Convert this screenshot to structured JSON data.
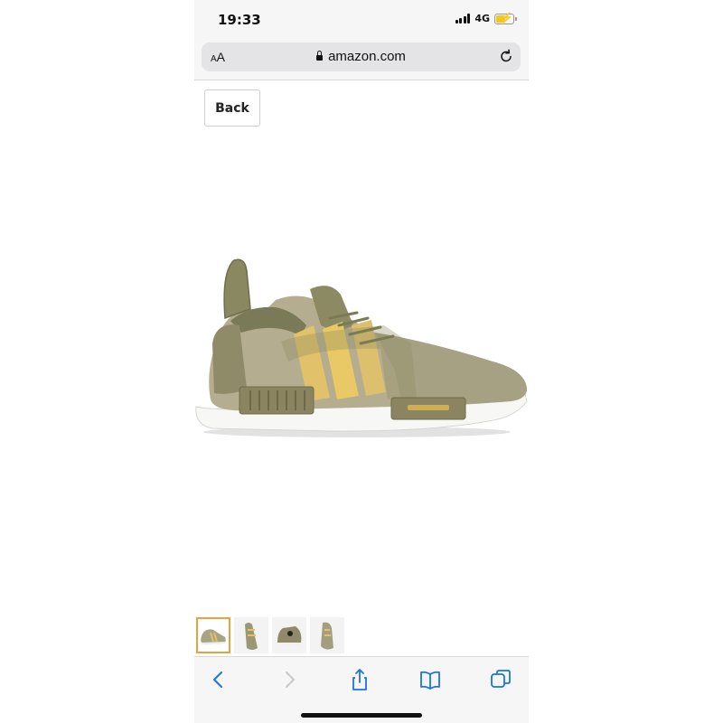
{
  "status_bar": {
    "time": "19:33",
    "network": "4G",
    "battery_level": 0.5,
    "battery_color": "#f5c518"
  },
  "browser": {
    "text_size_label_small": "A",
    "text_size_label_large": "A",
    "domain": "amazon.com",
    "lock_icon": "lock-icon",
    "reload_icon": "reload-icon"
  },
  "page": {
    "back_label": "Back",
    "product_image": "olive green sneaker with gold stripes and white sole",
    "thumbnails": [
      {
        "icon": "shoe-side-thumbnail",
        "selected": true
      },
      {
        "icon": "shoe-top-thumbnail",
        "selected": false
      },
      {
        "icon": "shoe-back-thumbnail",
        "selected": false
      },
      {
        "icon": "shoe-front-thumbnail",
        "selected": false
      }
    ],
    "selected_border_color": "#e9a23b"
  },
  "toolbar": {
    "items": [
      "back-icon",
      "forward-icon",
      "share-icon",
      "bookmarks-icon",
      "tabs-icon"
    ],
    "accent_color": "#1a73e8"
  }
}
